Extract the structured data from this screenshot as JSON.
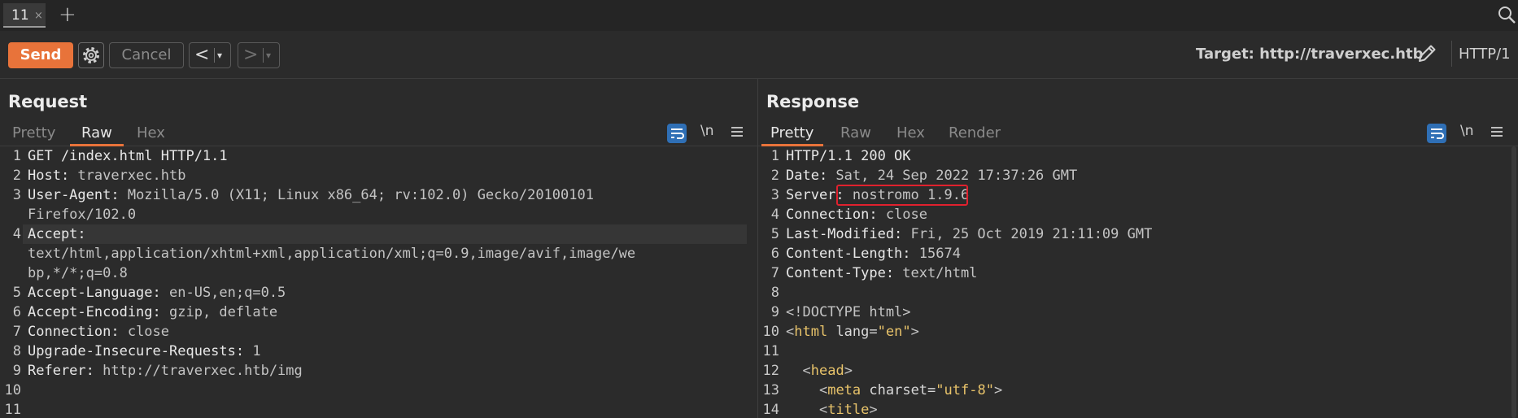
{
  "tabs": [
    {
      "label": "11",
      "close": "×"
    }
  ],
  "new_tab": "+",
  "toolbar": {
    "send_label": "Send",
    "cancel_label": "Cancel",
    "back_arrow": "<",
    "forward_arrow": ">",
    "dropdown": "▾",
    "target_label": "Target: http://traverxec.htb",
    "http_version": "HTTP/1"
  },
  "request": {
    "title": "Request",
    "tabs": [
      "Pretty",
      "Raw",
      "Hex"
    ],
    "active_tab": "Raw",
    "newline_label": "\\n",
    "lines": [
      {
        "n": "1",
        "k": "GET /index.html HTTP/1.1",
        "v": ""
      },
      {
        "n": "2",
        "k": "Host:",
        "v": " traverxec.htb"
      },
      {
        "n": "3",
        "k": "User-Agent:",
        "v": " Mozilla/5.0 (X11; Linux x86_64; rv:102.0) Gecko/20100101"
      },
      {
        "n": "",
        "k": "",
        "v": "Firefox/102.0"
      },
      {
        "n": "4",
        "k": "Accept:",
        "v": ""
      },
      {
        "n": "",
        "k": "",
        "v": "text/html,application/xhtml+xml,application/xml;q=0.9,image/avif,image/we"
      },
      {
        "n": "",
        "k": "",
        "v": "bp,*/*;q=0.8"
      },
      {
        "n": "5",
        "k": "Accept-Language:",
        "v": " en-US,en;q=0.5"
      },
      {
        "n": "6",
        "k": "Accept-Encoding:",
        "v": " gzip, deflate"
      },
      {
        "n": "7",
        "k": "Connection:",
        "v": " close"
      },
      {
        "n": "8",
        "k": "Upgrade-Insecure-Requests:",
        "v": " 1"
      },
      {
        "n": "9",
        "k": "Referer:",
        "v": " http://traverxec.htb/img"
      },
      {
        "n": "10",
        "k": "",
        "v": ""
      },
      {
        "n": "11",
        "k": "",
        "v": ""
      }
    ]
  },
  "response": {
    "title": "Response",
    "tabs": [
      "Pretty",
      "Raw",
      "Hex",
      "Render"
    ],
    "active_tab": "Pretty",
    "newline_label": "\\n",
    "headers": [
      {
        "n": "1",
        "k": "HTTP/1.1 200 OK",
        "v": ""
      },
      {
        "n": "2",
        "k": "Date:",
        "v": " Sat, 24 Sep 2022 17:37:26 GMT"
      },
      {
        "n": "3",
        "k": "Server:",
        "v": " nostromo 1.9.6"
      },
      {
        "n": "4",
        "k": "Connection:",
        "v": " close"
      },
      {
        "n": "5",
        "k": "Last-Modified:",
        "v": " Fri, 25 Oct 2019 21:11:09 GMT"
      },
      {
        "n": "6",
        "k": "Content-Length:",
        "v": " 15674"
      },
      {
        "n": "7",
        "k": "Content-Type:",
        "v": " text/html"
      },
      {
        "n": "8",
        "k": "",
        "v": ""
      }
    ],
    "html_lines": {
      "l9": {
        "n": "9",
        "text": "<!DOCTYPE html>"
      },
      "l10": {
        "n": "10",
        "open": "<",
        "tag": "html",
        "attr": " lang=",
        "val": "\"en\"",
        "close": ">"
      },
      "l11": {
        "n": "11"
      },
      "l12": {
        "n": "12",
        "indent": "  ",
        "open": "<",
        "tag": "head",
        "close": ">"
      },
      "l13": {
        "n": "13",
        "indent": "    ",
        "open": "<",
        "tag": "meta",
        "attr": " charset=",
        "val": "\"utf-8\"",
        "close": ">"
      },
      "l14": {
        "n": "14",
        "indent": "    ",
        "open": "<",
        "tag": "title",
        "close": ">"
      }
    }
  },
  "colors": {
    "accent": "#e8733a",
    "highlight": "#e0212e",
    "wrap_button": "#2f6fb5"
  }
}
